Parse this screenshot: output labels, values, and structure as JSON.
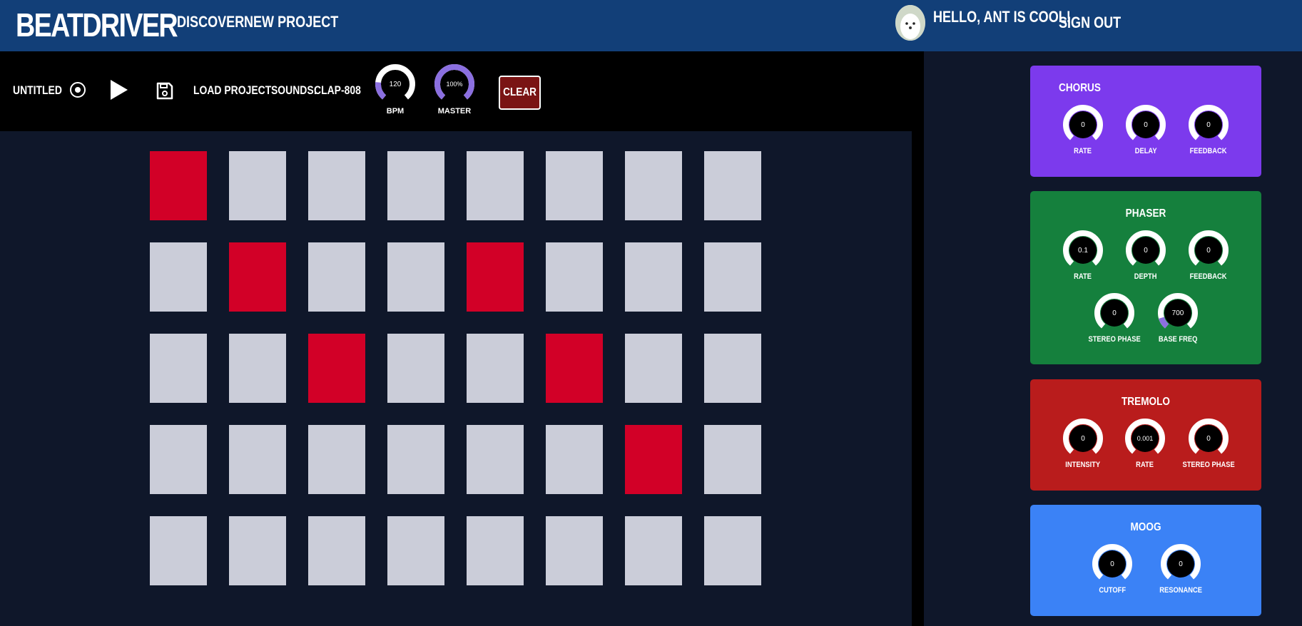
{
  "navbar": {
    "brand": "BEATDRIVER",
    "links": [
      "DISCOVER",
      "NEW PROJECT"
    ],
    "greeting": "HELLO, ANT IS COOL!",
    "signout": "SIGN OUT"
  },
  "toolbar": {
    "project_name": "UNTITLED",
    "load_project": "LOAD PROJECT",
    "sounds_label": "SOUNDS:",
    "sound_value": "CLAP-808",
    "knobs": [
      {
        "label": "BPM",
        "value": "120",
        "level": 0.2
      },
      {
        "label": "MASTER",
        "value": "100%",
        "level": 1.0
      }
    ],
    "clear": "CLEAR"
  },
  "grid": {
    "rows": [
      [
        true,
        false,
        false,
        false,
        false,
        false,
        false,
        false
      ],
      [
        false,
        true,
        false,
        false,
        true,
        false,
        false,
        false
      ],
      [
        false,
        false,
        true,
        false,
        false,
        true,
        false,
        false
      ],
      [
        false,
        false,
        false,
        false,
        false,
        false,
        true,
        false
      ],
      [
        false,
        false,
        false,
        false,
        false,
        false,
        false,
        false
      ]
    ]
  },
  "effects": [
    {
      "title": "CHORUS",
      "color": "#7c3aed",
      "params": [
        {
          "label": "RATE",
          "value": "0",
          "level": 0
        },
        {
          "label": "DELAY",
          "value": "0",
          "level": 0
        },
        {
          "label": "FEEDBACK",
          "value": "0",
          "level": 0
        }
      ]
    },
    {
      "title": "PHASER",
      "color": "#15803d",
      "params": [
        {
          "label": "RATE",
          "value": "0.1",
          "level": 0
        },
        {
          "label": "DEPTH",
          "value": "0",
          "level": 0
        },
        {
          "label": "FEEDBACK",
          "value": "0",
          "level": 0
        },
        {
          "label": "STEREO PHASE",
          "value": "0",
          "level": 0
        },
        {
          "label": "BASE FREQ",
          "value": "700",
          "level": 0.12
        }
      ]
    },
    {
      "title": "TREMOLO",
      "color": "#b91c1c",
      "params": [
        {
          "label": "INTENSITY",
          "value": "0",
          "level": 0
        },
        {
          "label": "RATE",
          "value": "0.001",
          "level": 0
        },
        {
          "label": "STEREO PHASE",
          "value": "0",
          "level": 0
        }
      ]
    },
    {
      "title": "MOOG",
      "color": "#3b82f6",
      "params": [
        {
          "label": "CUTOFF",
          "value": "0",
          "level": 0
        },
        {
          "label": "RESONANCE",
          "value": "0",
          "level": 0
        }
      ]
    }
  ],
  "colors": {
    "navbar": "#123f78",
    "pad_on": "#d20027",
    "pad_off": "#cbcdd9",
    "knob_accent": "#8b6fe0"
  }
}
